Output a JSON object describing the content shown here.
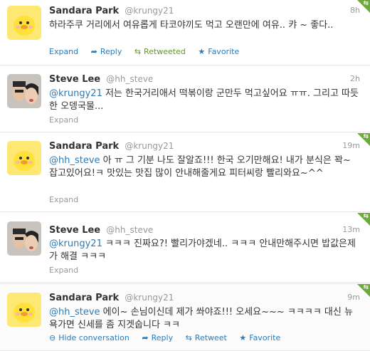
{
  "tweets": [
    {
      "name": "Sandara Park",
      "handle": "@krungy21",
      "time": "8h",
      "text": "하라주쿠 거리에서 여유롭게 타코야끼도 먹고 오랜만에 여유.. 캬 ~ 좋다..",
      "actions": {
        "expand": "Expand",
        "reply": "Reply",
        "retweeted": "Retweeted",
        "favorite": "Favorite"
      }
    },
    {
      "name": "Steve Lee",
      "handle": "@hh_steve",
      "time": "2h",
      "mention": "@krungy21",
      "text": " 저는 한국거리애서 떡볶이랑 군만두 먹고싶어요 ㅠㅠ. 그리고 따듯한 오뎅국물...",
      "actions": {
        "expand": "Expand"
      }
    },
    {
      "name": "Sandara Park",
      "handle": "@krungy21",
      "time": "19m",
      "mention": "@hh_steve",
      "text": " 아 ㅠ 그 기분 나도 잘알죠!!! 한국 오기만해요! 내가 분식은 꽉~ 잡고있어요!ㅋ 맛있는 맛집 많이 안내해줄게요 피터씨랑 빨리와요~^^",
      "actions": {
        "expand": "Expand"
      }
    },
    {
      "name": "Steve Lee",
      "handle": "@hh_steve",
      "time": "13m",
      "mention": "@krungy21",
      "text": " ㅋㅋㅋ 진짜요?! 빨리가야겠네.. ㅋㅋㅋ 안내만해주시면 밥값은제가 해결 ㅋㅋㅋ",
      "actions": {
        "expand": "Expand"
      }
    },
    {
      "name": "Sandara Park",
      "handle": "@krungy21",
      "time": "9m",
      "mention": "@hh_steve",
      "text": " 에이~ 손님이신데 제가 쏴야죠!!! 오세요~~~ ㅋㅋㅋㅋ 대신 뉴욕가면 신세를 좀 지겟숩니다 ㅋㅋ",
      "actions": {
        "hide": "Hide conversation",
        "reply": "Reply",
        "retweet": "Retweet",
        "favorite": "Favorite"
      }
    }
  ],
  "colors": {
    "link": "#2b7bb9",
    "retweet_green": "#609928",
    "corner_green": "#6cab3b",
    "muted": "#999999"
  },
  "icons": {
    "reply": "reply-arrow-icon",
    "retweet": "retweet-icon",
    "favorite": "star-icon",
    "hide": "collapse-circle-icon",
    "corner": "retweet-corner-icon"
  }
}
